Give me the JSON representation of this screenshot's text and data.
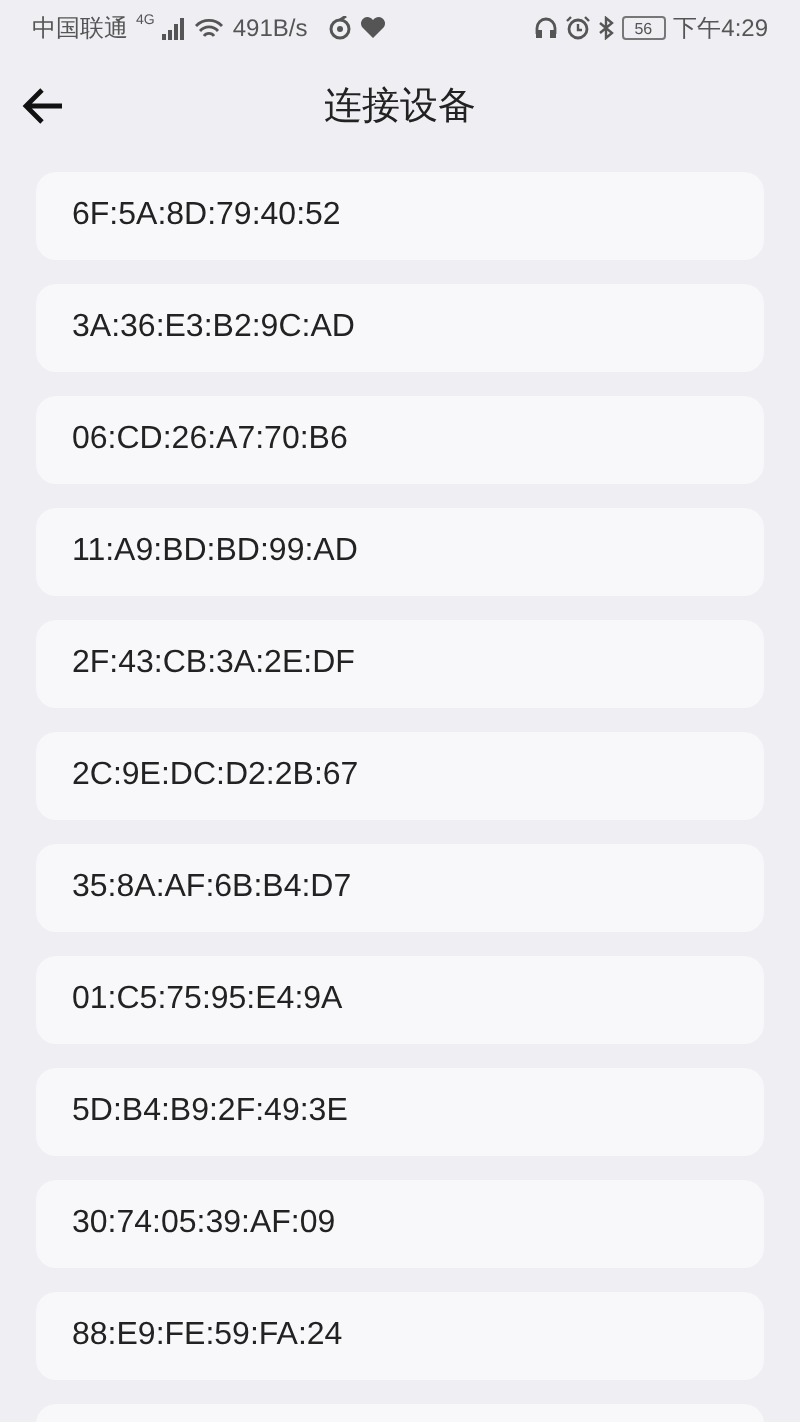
{
  "status_bar": {
    "carrier": "中国联通",
    "network": "4G",
    "speed": "491B/s",
    "battery": "56",
    "time": "下午4:29"
  },
  "header": {
    "title": "连接设备"
  },
  "devices": [
    {
      "address": "6F:5A:8D:79:40:52"
    },
    {
      "address": "3A:36:E3:B2:9C:AD"
    },
    {
      "address": "06:CD:26:A7:70:B6"
    },
    {
      "address": "11:A9:BD:BD:99:AD"
    },
    {
      "address": "2F:43:CB:3A:2E:DF"
    },
    {
      "address": "2C:9E:DC:D2:2B:67"
    },
    {
      "address": "35:8A:AF:6B:B4:D7"
    },
    {
      "address": "01:C5:75:95:E4:9A"
    },
    {
      "address": "5D:B4:B9:2F:49:3E"
    },
    {
      "address": "30:74:05:39:AF:09"
    },
    {
      "address": "88:E9:FE:59:FA:24"
    }
  ]
}
